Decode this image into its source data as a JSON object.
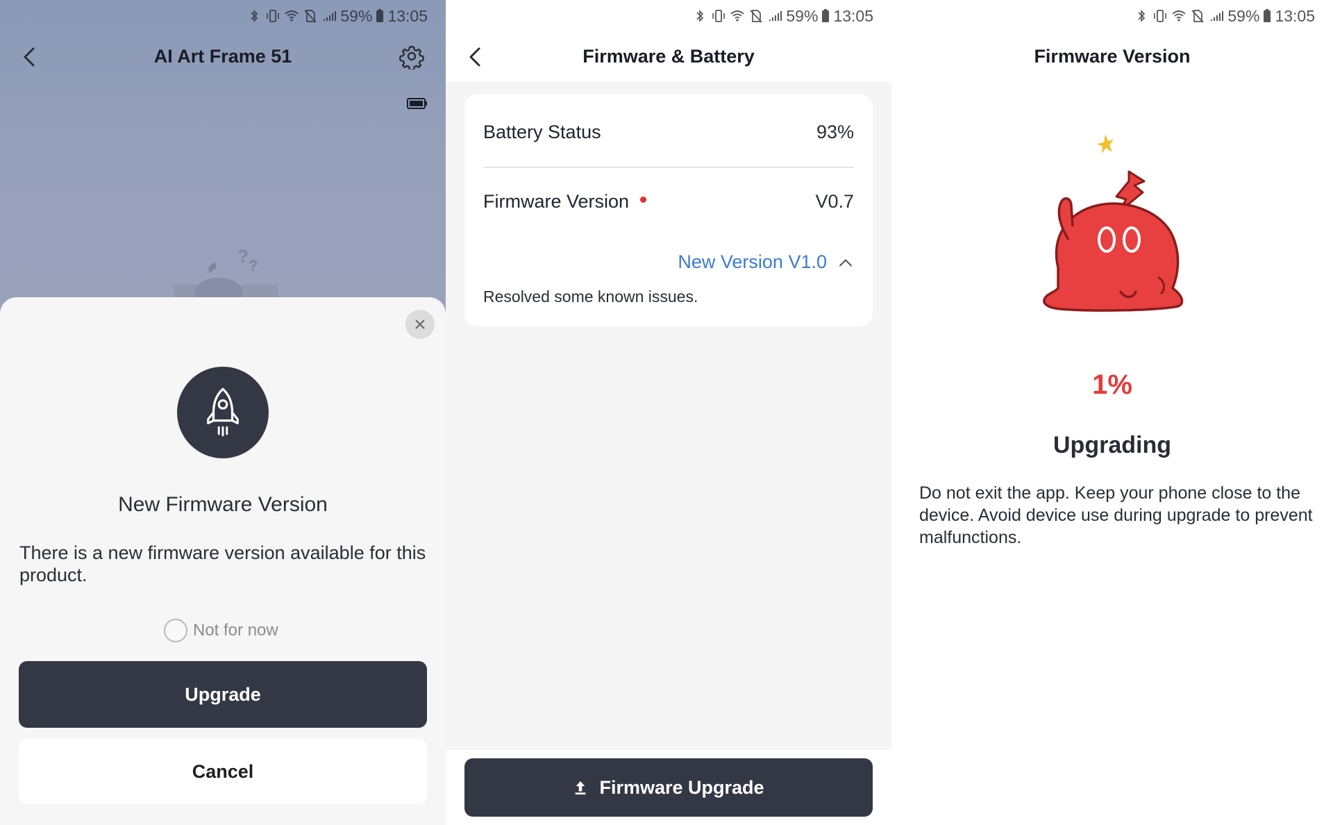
{
  "status_bar": {
    "battery_pct": "59%",
    "time": "13:05",
    "icons": [
      "bluetooth-icon",
      "vibrate-icon",
      "wifi-icon",
      "no-sim-icon",
      "signal-icon",
      "battery-icon"
    ]
  },
  "panel1": {
    "nav": {
      "title": "AI Art Frame 51",
      "back_icon": "chevron-left-icon",
      "settings_icon": "gear-icon"
    },
    "sheet": {
      "close_icon": "close-icon",
      "icon": "rocket-icon",
      "title": "New Firmware Version",
      "description": "There is a new firmware version available for this product.",
      "not_for_now": "Not for now",
      "upgrade_label": "Upgrade",
      "cancel_label": "Cancel"
    }
  },
  "panel2": {
    "nav": {
      "title": "Firmware & Battery",
      "back_icon": "chevron-left-icon"
    },
    "battery_status": {
      "label": "Battery Status",
      "value": "93%"
    },
    "firmware_version": {
      "label": "Firmware Version",
      "value": "V0.7"
    },
    "new_version": {
      "label": "New Version V1.0",
      "notes": "Resolved some known issues."
    },
    "upgrade_button": "Firmware Upgrade"
  },
  "panel3": {
    "nav": {
      "title": "Firmware Version"
    },
    "progress": "1%",
    "title": "Upgrading",
    "description": "Do not exit the app. Keep your phone close to the device. Avoid device use during upgrade to prevent malfunctions."
  },
  "colors": {
    "primary_button": "#343845",
    "accent_blue": "#3a7bd5",
    "accent_red": "#e33b3b",
    "mascot_red": "#e84040"
  }
}
